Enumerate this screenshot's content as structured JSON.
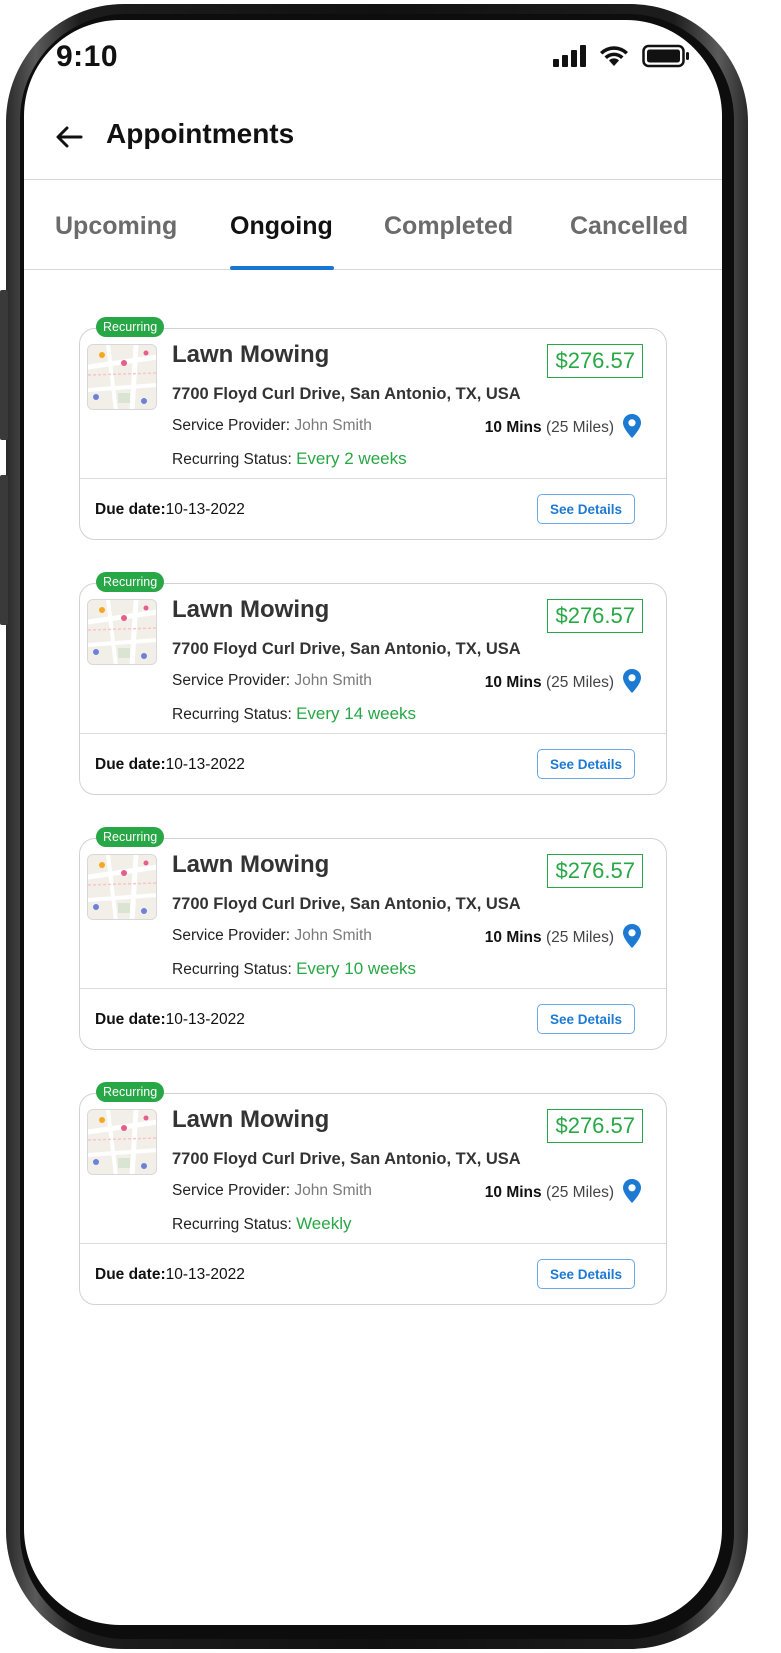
{
  "status_bar": {
    "time": "9:10"
  },
  "header": {
    "title": "Appointments"
  },
  "tabs": [
    {
      "label": "Upcoming",
      "active": false
    },
    {
      "label": "Ongoing",
      "active": true
    },
    {
      "label": "Completed",
      "active": false
    },
    {
      "label": "Cancelled",
      "active": false
    }
  ],
  "labels": {
    "provider_label": "Service Provider:",
    "recurring_status_label": "Recurring Status:",
    "due_label": "Due date:",
    "see_details": "See Details",
    "distance_time": "10 Mins",
    "distance_miles": "(25 Miles)"
  },
  "appointments": [
    {
      "badge": "Recurring",
      "service": "Lawn Mowing",
      "price": "$276.57",
      "address": "7700 Floyd Curl Drive, San Antonio, TX, USA",
      "provider": "John Smith",
      "recurring": "Every 2 weeks",
      "due_date": "10-13-2022"
    },
    {
      "badge": "Recurring",
      "service": "Lawn Mowing",
      "price": "$276.57",
      "address": "7700 Floyd Curl Drive, San Antonio, TX, USA",
      "provider": "John Smith",
      "recurring": "Every 14 weeks",
      "due_date": "10-13-2022"
    },
    {
      "badge": "Recurring",
      "service": "Lawn Mowing",
      "price": "$276.57",
      "address": "7700 Floyd Curl Drive, San Antonio, TX, USA",
      "provider": "John Smith",
      "recurring": "Every 10 weeks",
      "due_date": "10-13-2022"
    },
    {
      "badge": "Recurring",
      "service": "Lawn Mowing",
      "price": "$276.57",
      "address": "7700 Floyd Curl Drive, San Antonio, TX, USA",
      "provider": "John Smith",
      "recurring": "Weekly",
      "due_date": "10-13-2022"
    }
  ],
  "colors": {
    "accent_green": "#27a745",
    "tab_indicator": "#1976d2",
    "link_blue": "#1d7ad3"
  },
  "icons": {
    "back": "arrow-left-icon",
    "pin": "location-pin-icon",
    "signal": "signal-icon",
    "wifi": "wifi-icon",
    "battery": "battery-icon"
  }
}
